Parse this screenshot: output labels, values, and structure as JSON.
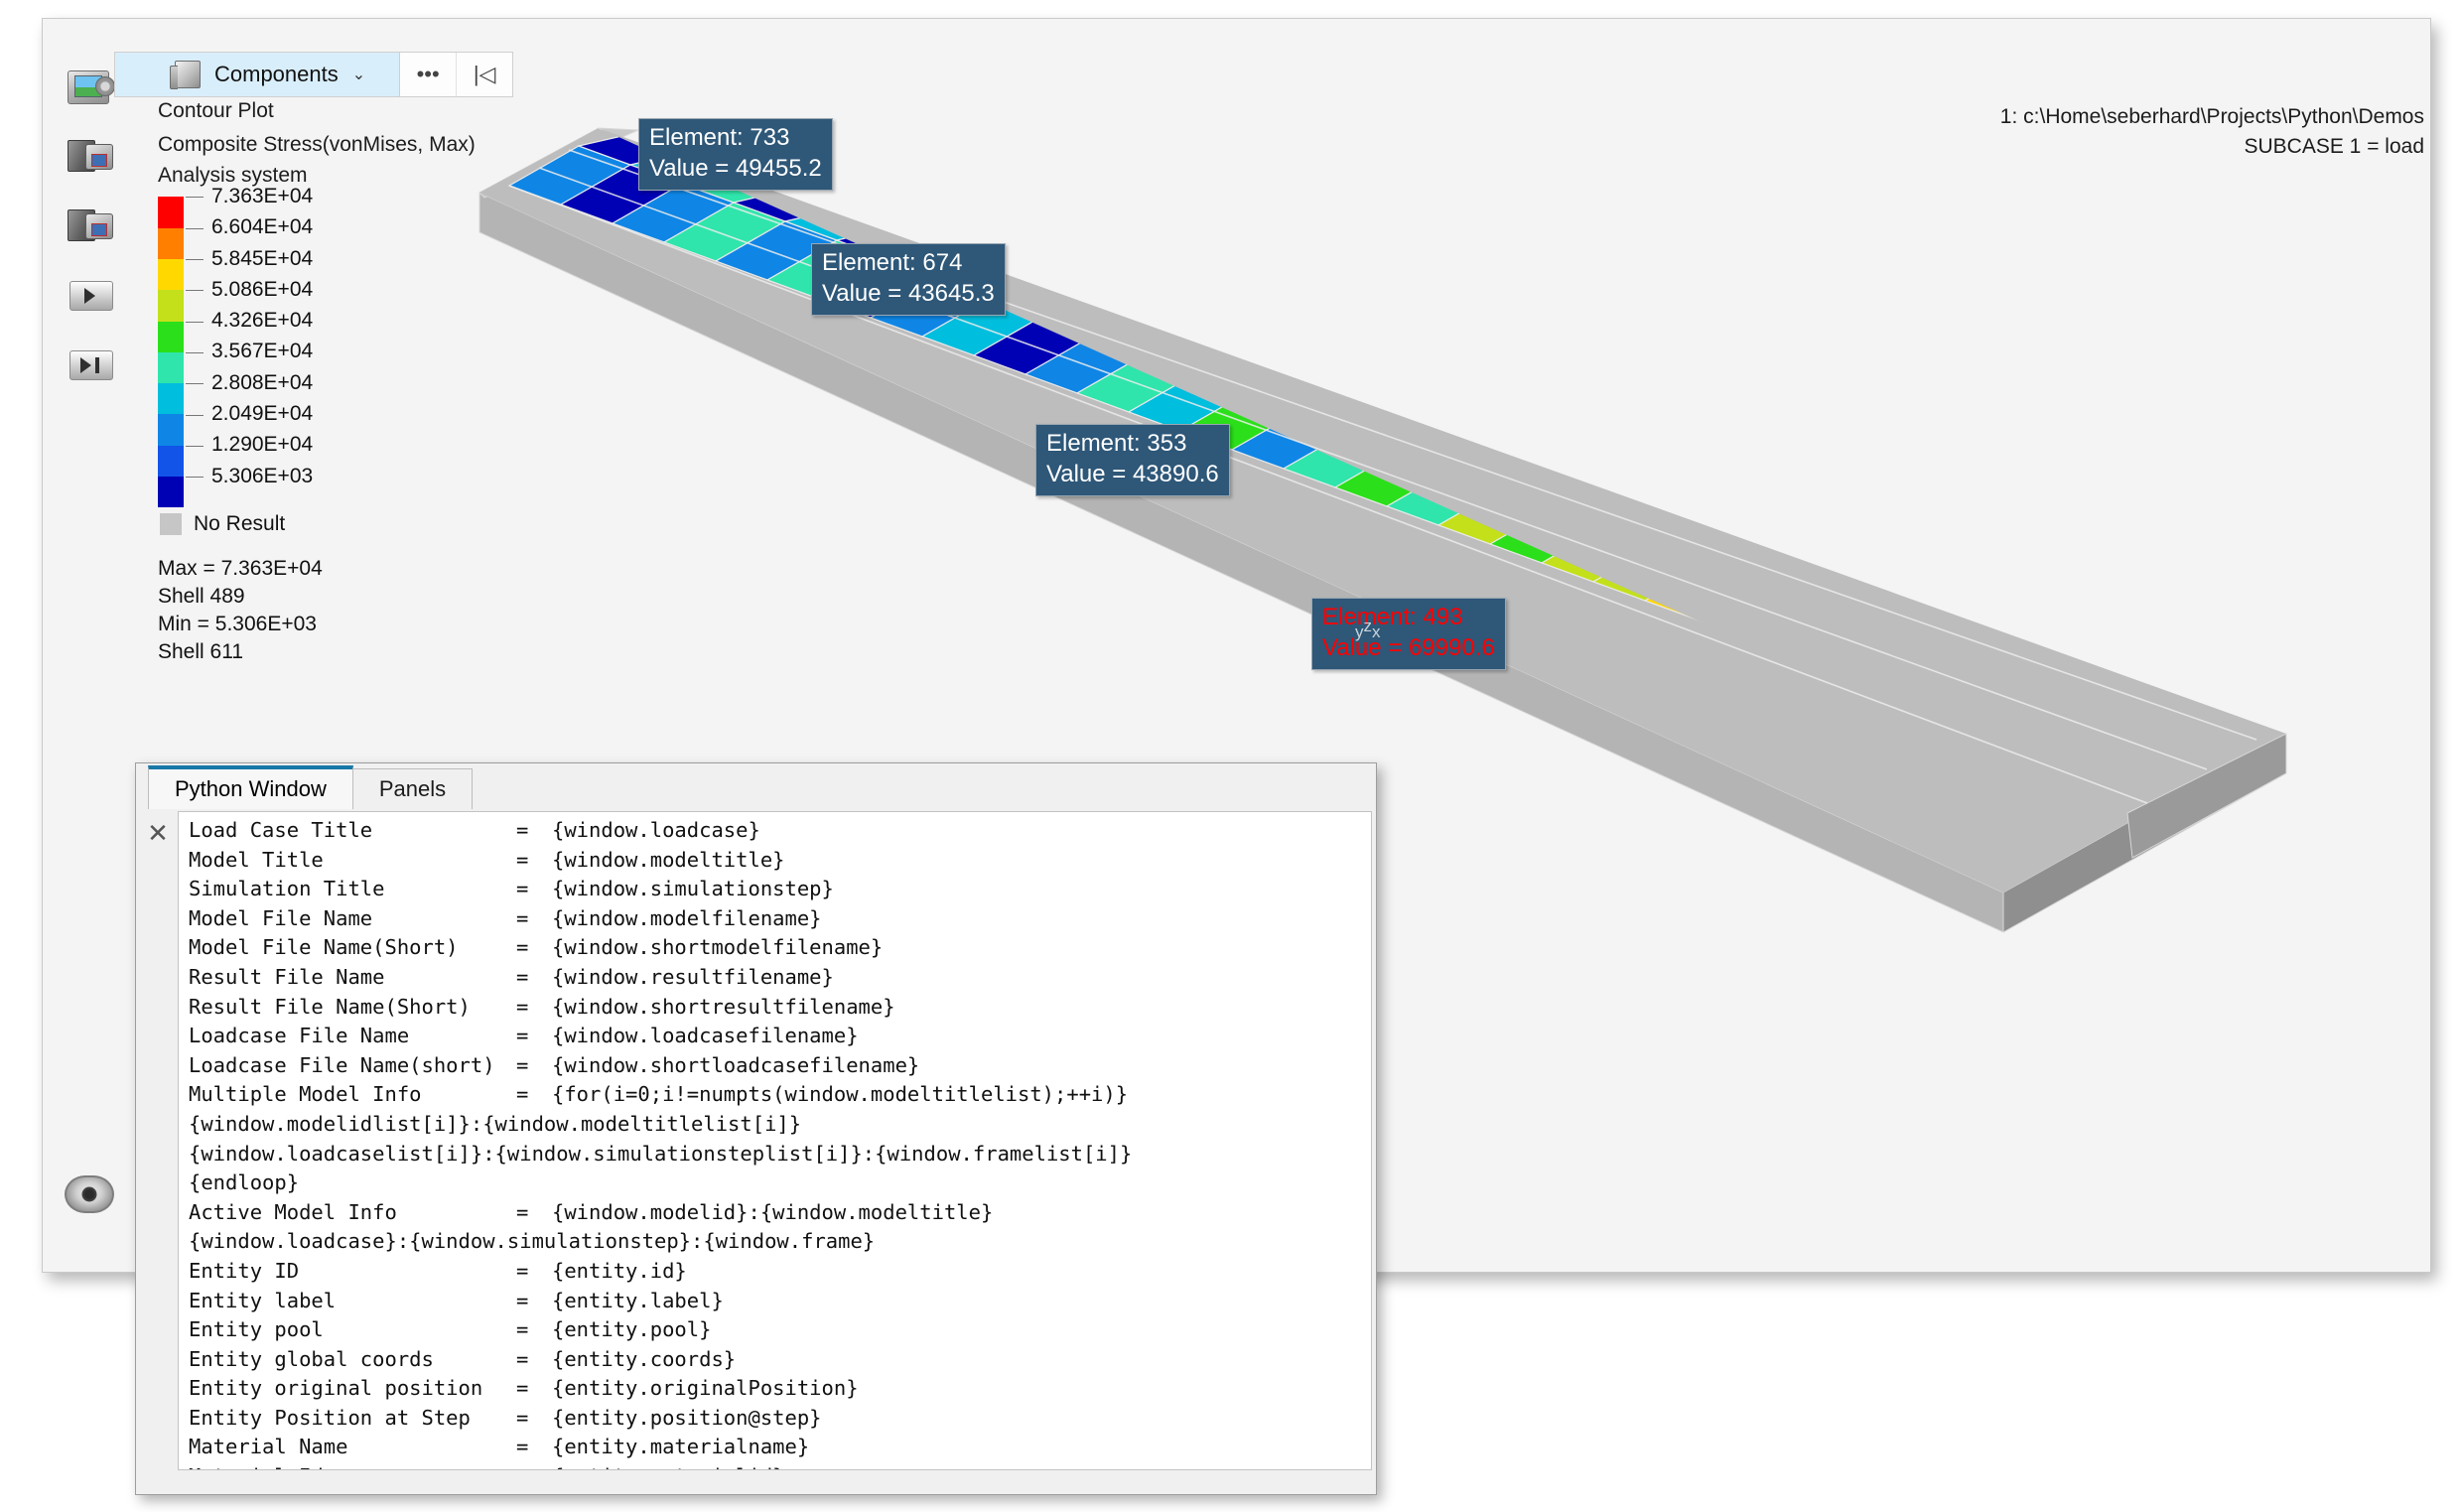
{
  "toolbar": {
    "components_label": "Components",
    "chevron": "⌄",
    "more_label": "•••",
    "collapse_label": "|◁",
    "icons": [
      {
        "name": "capture-plot-icon"
      },
      {
        "name": "capture-session-icon"
      },
      {
        "name": "capture-session-alt-icon"
      },
      {
        "name": "animate-play-icon"
      },
      {
        "name": "animate-step-icon"
      },
      {
        "name": "visibility-eye-icon"
      }
    ]
  },
  "legend": {
    "title_line1": "Contour Plot",
    "title_line2": "Composite Stress(vonMises, Max)",
    "title_line3": "Analysis system",
    "entries": [
      {
        "value": "7.363E+04",
        "color": "#ff0000"
      },
      {
        "value": "6.604E+04",
        "color": "#ff7f00"
      },
      {
        "value": "5.845E+04",
        "color": "#ffd800"
      },
      {
        "value": "5.086E+04",
        "color": "#c3e01a"
      },
      {
        "value": "4.326E+04",
        "color": "#2be01a"
      },
      {
        "value": "3.567E+04",
        "color": "#2fe5ab"
      },
      {
        "value": "2.808E+04",
        "color": "#00bedd"
      },
      {
        "value": "2.049E+04",
        "color": "#0f86e6"
      },
      {
        "value": "1.290E+04",
        "color": "#1254e8"
      },
      {
        "value": "5.306E+03",
        "color": "#0000b4"
      }
    ],
    "no_result_label": "No Result",
    "no_result_color": "#c6c6c6",
    "max_label": "Max =  7.363E+04",
    "max_entity": "Shell 489",
    "min_label": "Min =  5.306E+03",
    "min_entity": "Shell 611"
  },
  "header": {
    "line1": "1: c:\\Home\\seberhard\\Projects\\Python\\Demos",
    "line2": "SUBCASE 1 = load"
  },
  "tooltips": [
    {
      "element": "Element: 733",
      "value": "Value = 49455.2",
      "color": "white"
    },
    {
      "element": "Element: 674",
      "value": "Value = 43645.3",
      "color": "white"
    },
    {
      "element": "Element: 353",
      "value": "Value = 43890.6",
      "color": "white"
    },
    {
      "element": "Element: 493",
      "value": "Value = 69990.6",
      "color": "red"
    }
  ],
  "axis_triad": {
    "x": "x",
    "y": "y",
    "z": "z"
  },
  "python_window": {
    "tabs": [
      {
        "label": "Python Window",
        "active": true
      },
      {
        "label": "Panels",
        "active": false
      }
    ],
    "close_label": "✕",
    "lines": [
      {
        "key": "Load Case Title",
        "eq": "=",
        "val": "{window.loadcase}"
      },
      {
        "key": "Model Title",
        "eq": "=",
        "val": "{window.modeltitle}"
      },
      {
        "key": "Simulation Title",
        "eq": "=",
        "val": "{window.simulationstep}"
      },
      {
        "key": "Model File Name",
        "eq": "=",
        "val": "{window.modelfilename}"
      },
      {
        "key": "Model File Name(Short)",
        "eq": "=",
        "val": "{window.shortmodelfilename}"
      },
      {
        "key": "Result File Name",
        "eq": "=",
        "val": "{window.resultfilename}"
      },
      {
        "key": "Result File Name(Short)",
        "eq": "=",
        "val": "{window.shortresultfilename}"
      },
      {
        "key": "Loadcase File Name",
        "eq": "=",
        "val": "{window.loadcasefilename}"
      },
      {
        "key": "Loadcase File Name(short)",
        "eq": "=",
        "val": "{window.shortloadcasefilename}"
      },
      {
        "key": "Multiple Model Info",
        "eq": "=",
        "val": "{for(i=0;i!=numpts(window.modeltitlelist);++i)}"
      },
      {
        "key": "",
        "eq": "",
        "val": "{window.modelidlist[i]}:{window.modeltitlelist[i]}"
      },
      {
        "key": "",
        "eq": "",
        "val": "{window.loadcaselist[i]}:{window.simulationsteplist[i]}:{window.framelist[i]}"
      },
      {
        "key": "",
        "eq": "",
        "val": "{endloop}"
      },
      {
        "key": "Active Model Info",
        "eq": "=",
        "val": "{window.modelid}:{window.modeltitle}"
      },
      {
        "key": "",
        "eq": "",
        "val": "{window.loadcase}:{window.simulationstep}:{window.frame}"
      },
      {
        "key": "Entity ID",
        "eq": "=",
        "val": "{entity.id}"
      },
      {
        "key": "Entity label",
        "eq": "=",
        "val": "{entity.label}"
      },
      {
        "key": "Entity pool",
        "eq": "=",
        "val": "{entity.pool}"
      },
      {
        "key": "Entity global coords",
        "eq": "=",
        "val": "{entity.coords}"
      },
      {
        "key": "Entity original position",
        "eq": "=",
        "val": "{entity.originalPosition}"
      },
      {
        "key": "Entity Position at Step",
        "eq": "=",
        "val": "{entity.position@step}"
      },
      {
        "key": "Material Name",
        "eq": "=",
        "val": "{entity.materialname}"
      },
      {
        "key": "Material Id",
        "eq": "=",
        "val": "{entity.materialid}"
      }
    ]
  },
  "model": {
    "description": "3D FE shell plate contour plot, isometric view",
    "side_color": "#b4b4b4",
    "end_color": "#8c8c8c",
    "mesh_line_color": "#e8e8e8"
  }
}
